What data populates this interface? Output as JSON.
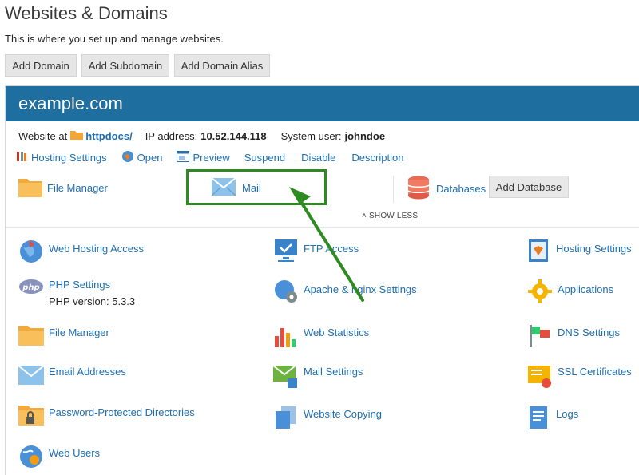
{
  "header": {
    "title": "Websites & Domains",
    "description": "This is where you set up and manage websites."
  },
  "toolbar": {
    "add_domain": "Add Domain",
    "add_subdomain": "Add Subdomain",
    "add_domain_alias": "Add Domain Alias"
  },
  "domain": {
    "name": "example.com",
    "website_at_label": "Website at",
    "docroot": "httpdocs/",
    "ip_label": "IP address:",
    "ip": "10.52.144.118",
    "user_label": "System user:",
    "user": "johndoe"
  },
  "actions": {
    "hosting_settings": "Hosting Settings",
    "open": "Open",
    "preview": "Preview",
    "suspend": "Suspend",
    "disable": "Disable",
    "description": "Description"
  },
  "tools": {
    "file_manager": "File Manager",
    "mail": "Mail",
    "databases": "Databases",
    "add_database": "Add Database",
    "show_less": "SHOW LESS"
  },
  "grid": {
    "web_hosting_access": "Web Hosting Access",
    "ftp_access": "FTP Access",
    "hosting_settings": "Hosting Settings",
    "php_settings": "PHP Settings",
    "php_version": "PHP version: 5.3.3",
    "apache_nginx": "Apache & nginx Settings",
    "applications": "Applications",
    "file_manager": "File Manager",
    "web_statistics": "Web Statistics",
    "dns_settings": "DNS Settings",
    "email_addresses": "Email Addresses",
    "mail_settings": "Mail Settings",
    "ssl_certificates": "SSL Certificates",
    "password_dirs": "Password-Protected Directories",
    "website_copying": "Website Copying",
    "logs": "Logs",
    "web_users": "Web Users"
  },
  "colors": {
    "accent": "#1f6ea0",
    "link": "#1f6fb2",
    "highlight": "#2e8b22"
  }
}
